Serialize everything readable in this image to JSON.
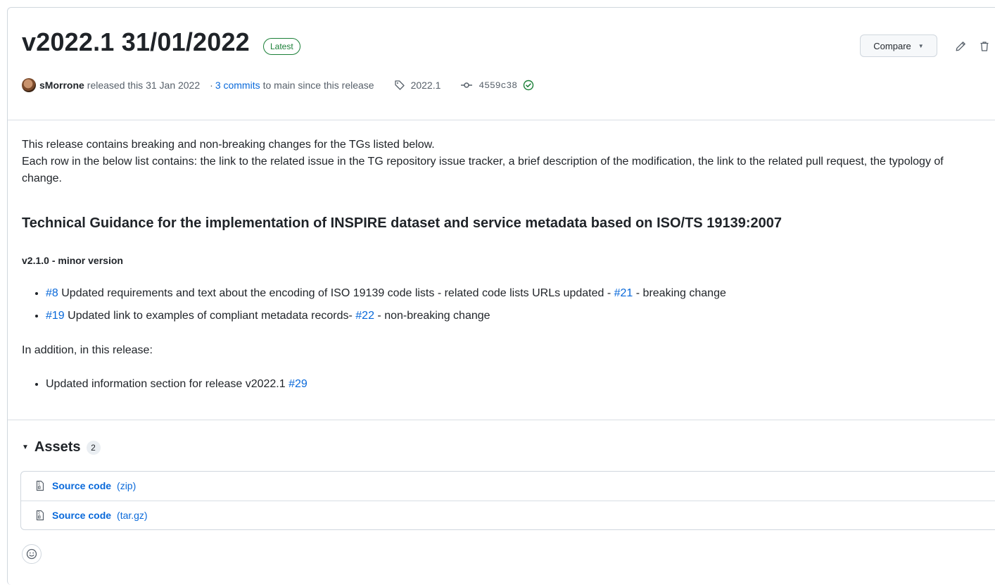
{
  "release": {
    "title": "v2022.1 31/01/2022",
    "badge": "Latest",
    "compare_label": "Compare",
    "author": "sMorrone",
    "released_text": "released this 31 Jan 2022",
    "commits_prefix": "·",
    "commits_link": "3 commits",
    "commits_suffix": "to main since this release",
    "tag": "2022.1",
    "commit_sha": "4559c38"
  },
  "body": {
    "intro_line1": "This release contains breaking and non-breaking changes for the TGs listed below.",
    "intro_line2": "Each row in the below list contains: the link to the related issue in the TG repository issue tracker, a brief description of the modification, the link to the related pull request, the typology of change.",
    "heading": "Technical Guidance for the implementation of INSPIRE dataset and service metadata based on ISO/TS 19139:2007",
    "subheading": "v2.1.0 - minor version",
    "changes": [
      {
        "issue": "#8",
        "text": "Updated requirements and text about the encoding of ISO 19139 code lists - related code lists URLs updated -",
        "pr": "#21",
        "type": "- breaking change"
      },
      {
        "issue": "#19",
        "text": "Updated link to examples of compliant metadata records-",
        "pr": "#22",
        "type": "- non-breaking change"
      }
    ],
    "addition_label": "In addition, in this release:",
    "addition_item_text": "Updated information section for release v2022.1",
    "addition_item_link": "#29"
  },
  "assets": {
    "title": "Assets",
    "count": "2",
    "items": [
      {
        "name": "Source code",
        "ext": "(zip)"
      },
      {
        "name": "Source code",
        "ext": "(tar.gz)"
      }
    ]
  },
  "colors": {
    "link": "#0969da",
    "success": "#1a7f37",
    "border": "#d0d7de",
    "text": "#1f2328",
    "muted": "#57606a"
  },
  "icons": {
    "tag": "tag-icon",
    "commit": "git-commit-icon",
    "verified": "check-circle-icon",
    "edit": "pencil-icon",
    "delete": "trash-icon",
    "file": "file-zip-icon",
    "reaction": "smiley-icon",
    "disclosure": "triangle-down-icon"
  }
}
